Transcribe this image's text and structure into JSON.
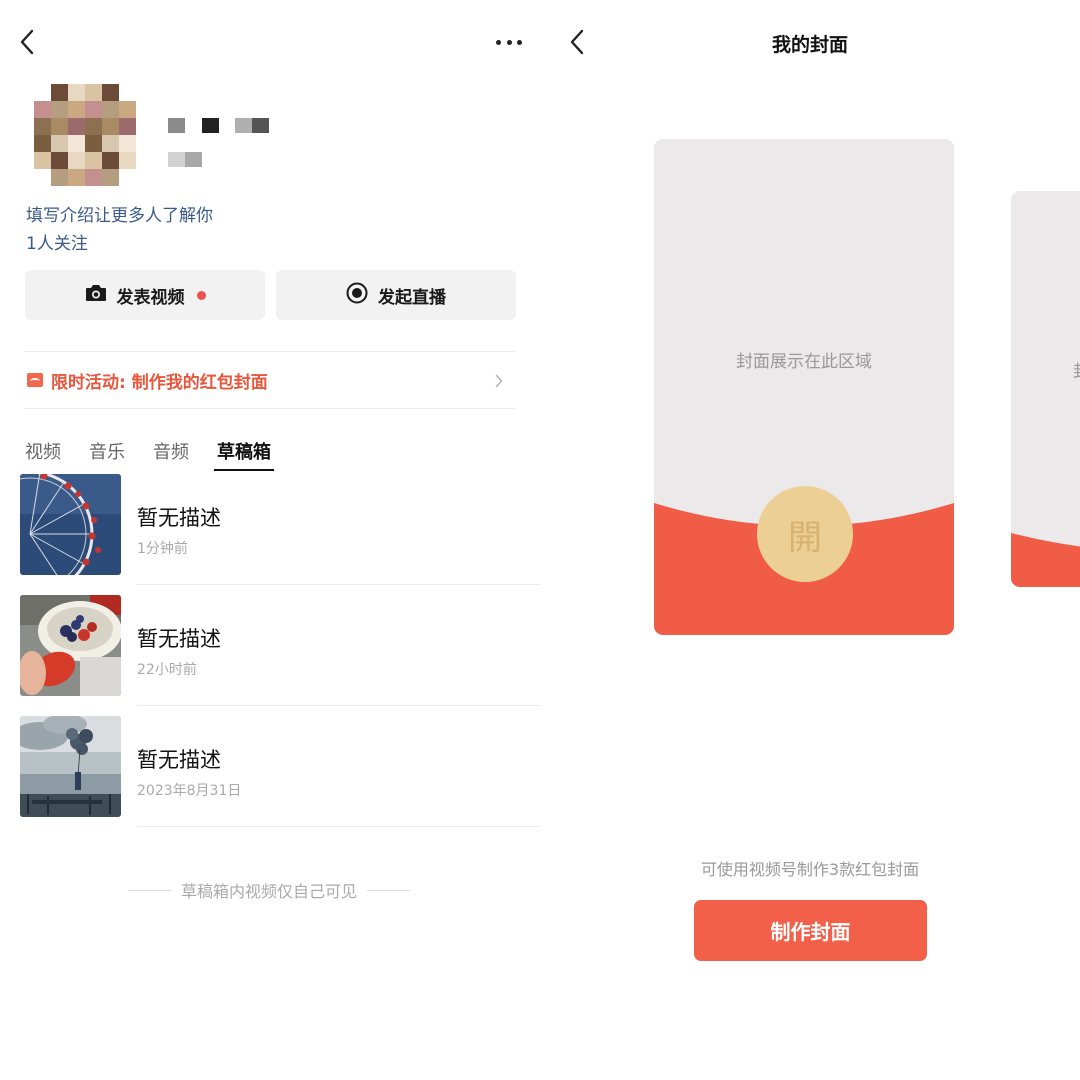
{
  "left_panel": {
    "profile": {
      "intro_prompt": "填写介绍让更多人了解你",
      "followers": "1人关注"
    },
    "actions": {
      "post_video": "发表视频",
      "start_live": "发起直播"
    },
    "promo": {
      "text": "限时活动: 制作我的红包封面"
    },
    "tabs": [
      {
        "label": "视频",
        "active": false
      },
      {
        "label": "音乐",
        "active": false
      },
      {
        "label": "音频",
        "active": false
      },
      {
        "label": "草稿箱",
        "active": true
      }
    ],
    "drafts": [
      {
        "title": "暂无描述",
        "time": "1分钟前",
        "thumbnail_icon": "ferris-wheel-image"
      },
      {
        "title": "暂无描述",
        "time": "22小时前",
        "thumbnail_icon": "fruit-bowl-image"
      },
      {
        "title": "暂无描述",
        "time": "2023年8月31日",
        "thumbnail_icon": "balloons-seaside-image"
      }
    ],
    "footnote": "草稿箱内视频仅自己可见"
  },
  "right_panel": {
    "title": "我的封面",
    "cover": {
      "placeholder": "封面展示在此区域",
      "open_char": "開",
      "next_peek": "封"
    },
    "usage": "可使用视频号制作3款红包封面",
    "make_button": "制作封面"
  },
  "colors": {
    "accent_red": "#f2604a",
    "promo_red": "#e8573c",
    "link_blue": "#3a5a8a",
    "open_gold": "#eccf95"
  }
}
